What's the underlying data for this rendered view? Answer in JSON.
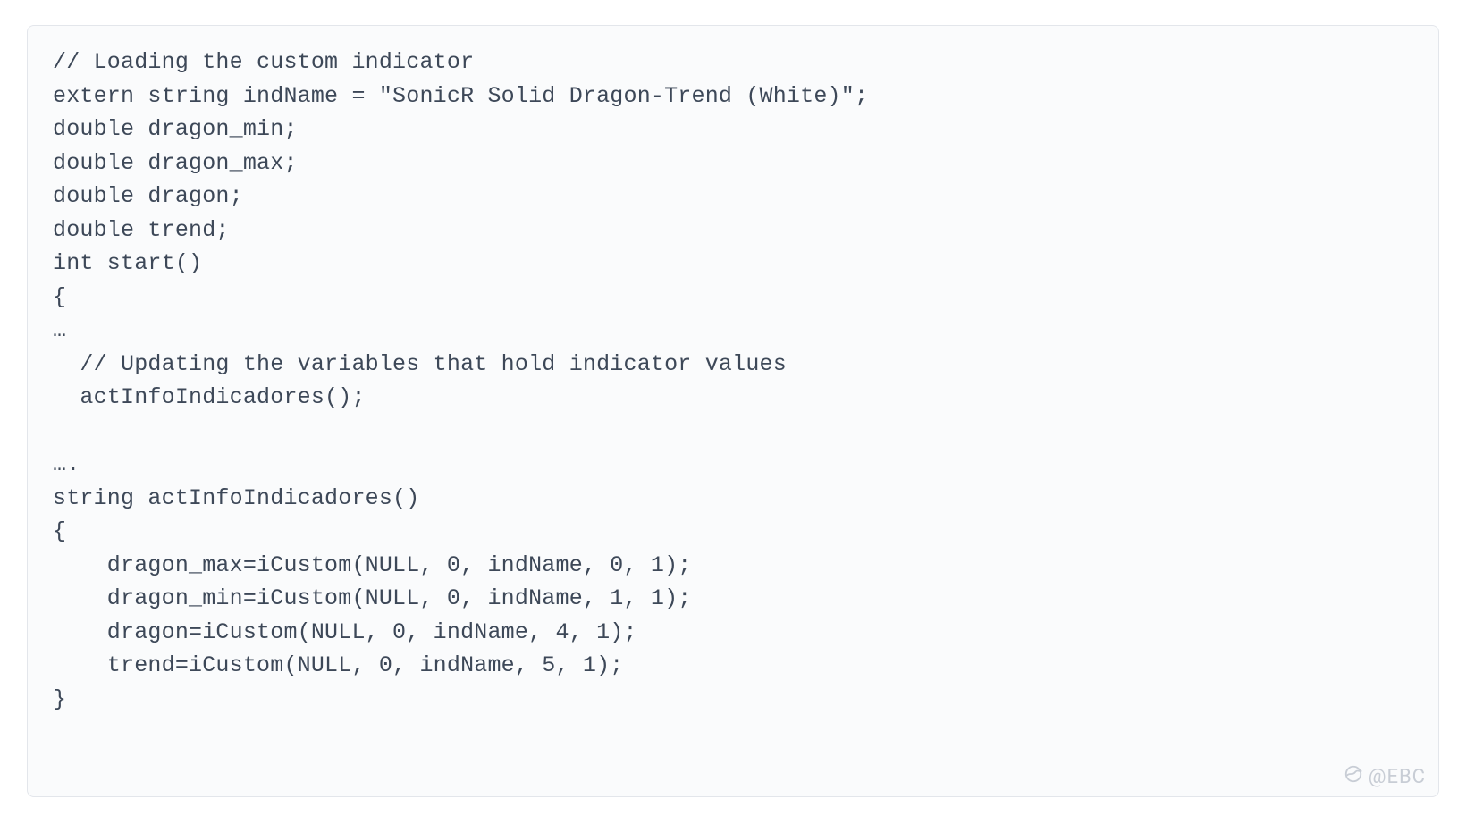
{
  "code": "// Loading the custom indicator\nextern string indName = \"SonicR Solid Dragon-Trend (White)\";\ndouble dragon_min;\ndouble dragon_max;\ndouble dragon;\ndouble trend;\nint start()\n{\n…\n  // Updating the variables that hold indicator values\n  actInfoIndicadores();\n\n….\nstring actInfoIndicadores()\n{\n    dragon_max=iCustom(NULL, 0, indName, 0, 1);\n    dragon_min=iCustom(NULL, 0, indName, 1, 1);\n    dragon=iCustom(NULL, 0, indName, 4, 1);\n    trend=iCustom(NULL, 0, indName, 5, 1);\n}",
  "watermark": "@EBC"
}
